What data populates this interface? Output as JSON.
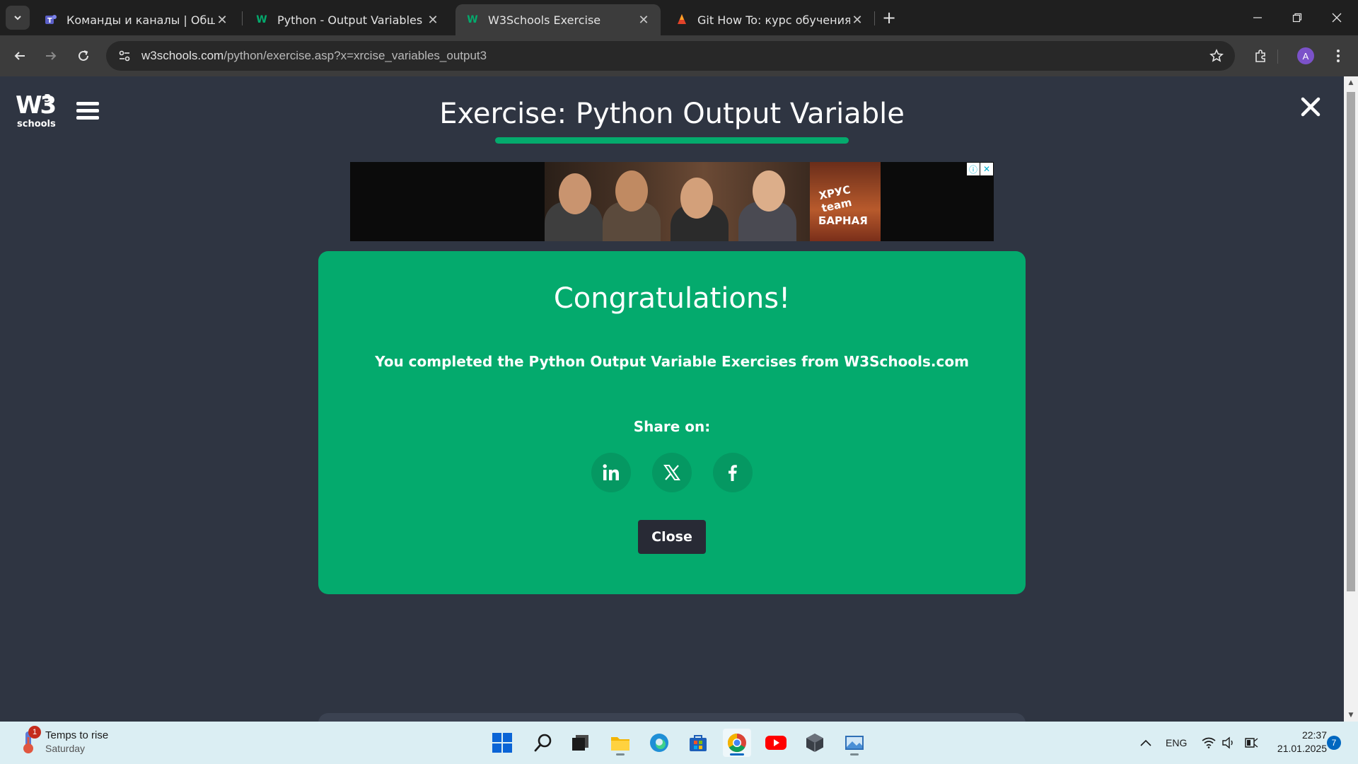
{
  "browser": {
    "tabs": [
      {
        "title": "Команды и каналы | Общий | М",
        "favicon": "teams-icon",
        "active": false
      },
      {
        "title": "Python - Output Variables",
        "favicon": "w3schools-icon",
        "active": false
      },
      {
        "title": "W3Schools Exercise",
        "favicon": "w3schools-icon",
        "active": true
      },
      {
        "title": "Git How To: курс обучения Git",
        "favicon": "git-icon",
        "active": false
      }
    ],
    "url_host": "w3schools.com",
    "url_path": "/python/exercise.asp?x=xrcise_variables_output3",
    "profile_initial": "A"
  },
  "page": {
    "logo_text": "W3",
    "logo_sup": "3",
    "logo_sub": "schools",
    "title": "Exercise: Python Output Variable",
    "accent_color": "#04aa6d",
    "ad": {
      "brand": "ХРУС team",
      "product": "БАРНАЯ"
    },
    "modal": {
      "heading": "Congratulations!",
      "message": "You completed the Python Output Variable Exercises from W3Schools.com",
      "share_label": "Share on:",
      "share_targets": [
        "linkedin-icon",
        "x-icon",
        "facebook-icon"
      ],
      "close_label": "Close"
    }
  },
  "taskbar": {
    "weather_title": "Temps to rise",
    "weather_sub": "Saturday",
    "weather_badge": "1",
    "language": "ENG",
    "time": "22:37",
    "date": "21.01.2025",
    "notifications": "7"
  }
}
